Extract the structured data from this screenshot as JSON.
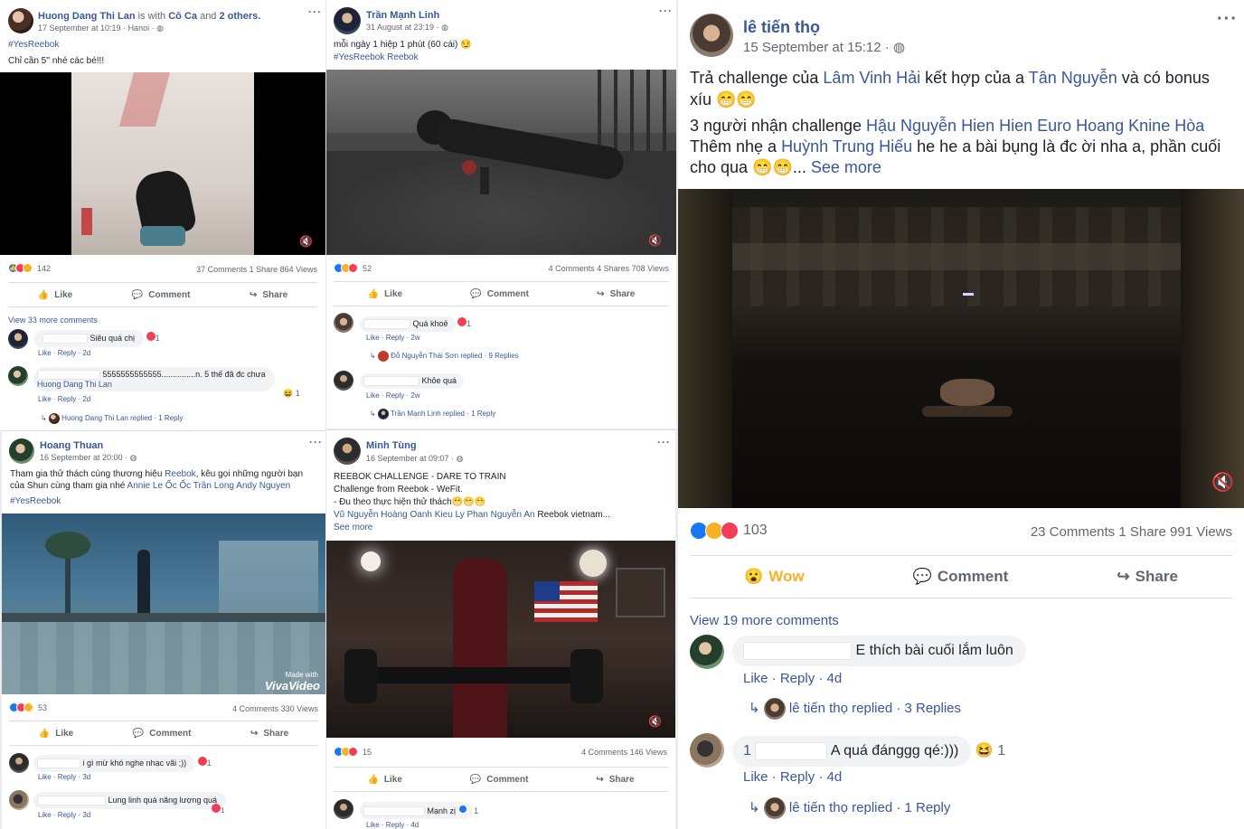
{
  "post1": {
    "author": "Huong Dang Thi Lan",
    "with_text": " is with ",
    "with_1": "Cô Ca",
    "with_and": " and ",
    "with_2": "2 others.",
    "time": "17 September at 10:19 · Hanoi ·",
    "hashtag": "#YesReebok",
    "text": "Chỉ cần 5'' nhé các bé!!!",
    "reactions": "142",
    "stats": "37 Comments  1 Share  864 Views",
    "like": "Like",
    "comment": "Comment",
    "share": "Share",
    "view_more": "View 33 more comments",
    "comments": [
      {
        "text": "Siêu quá chị",
        "count": "1",
        "meta": "Like · Reply · 2d"
      },
      {
        "text": "5555555555555...............n. 5 thế đã đc chưa",
        "tag": "Huong Dang Thi Lan",
        "count": "1",
        "meta": "Like · Reply · 2d",
        "replied": "Huong Dang Thi Lan replied · 1 Reply"
      }
    ]
  },
  "post2": {
    "author": "Trần Mạnh Linh",
    "time": "31 August at 23:19 ·",
    "text": "mỗi ngày 1 hiệp 1 phút (60 cái) 😏",
    "hashtags": "#YesReebok Reebok",
    "reactions": "52",
    "stats": "4 Comments  4 Shares  708 Views",
    "like": "Like",
    "comment": "Comment",
    "share": "Share",
    "comments": [
      {
        "text": "Quá khoẻ",
        "count": "1",
        "meta": "Like · Reply · 2w",
        "replied": "Đỗ Nguyễn Thái Sơn replied · 9 Replies"
      },
      {
        "text": "Khỏe quá",
        "meta": "Like · Reply · 2w",
        "replied": "Trần Mạnh Linh replied · 1 Reply"
      }
    ]
  },
  "post3": {
    "author": "lê tiến thọ",
    "time": "15 September at 15:12 ·",
    "line1_a": "Trả challenge của ",
    "line1_b": "Lâm Vinh Hải",
    "line1_c": " kết hợp của a ",
    "line1_d": "Tân Nguyễn",
    "line1_e": " và có bonus",
    "line2": "xíu 😁😁",
    "line3_a": "3 người nhận challenge ",
    "line3_b": "Hậu Nguyễn Hien Hien Euro Hoang Knine Hòa",
    "line4_a": "Thêm nhẹ a ",
    "line4_b": "Huỳnh Trung Hiếu",
    "line4_c": " he he a bài bụng là đc ời nha a, phần cuối",
    "line5_a": "cho qua 😁😁... ",
    "line5_b": "See more",
    "reactions": "103",
    "stats": "23 Comments  1 Share  991 Views",
    "wow": "Wow",
    "comment": "Comment",
    "share": "Share",
    "view_more": "View 19 more comments",
    "comments": [
      {
        "text": "E thích bài cuối lắm luôn",
        "meta": "Like · Reply · 4d",
        "replied": "lê tiến thọ replied · 3 Replies"
      },
      {
        "prefix": "1",
        "text": "A quá đánggg qé:)))",
        "count": "1",
        "meta": "Like · Reply · 4d",
        "replied": "lê tiến thọ replied · 1 Reply"
      }
    ]
  },
  "post4": {
    "author": "Hoang Thuan",
    "time": "16 September at 20:00 ·",
    "text_a": "Tham gia thử thách cùng thương hiệu ",
    "text_b": "Reebok",
    "text_c": ", kêu gọi những người bạn",
    "line2_a": "của Shun cùng tham gia nhé ",
    "line2_b": "Annie Le Ốc Ốc Trần Long Andy Nguyen",
    "hashtag": "#YesReebok",
    "watermark_small": "Made with",
    "watermark": "VivaVideo",
    "reactions": "53",
    "stats": "4 Comments  330 Views",
    "like": "Like",
    "comment": "Comment",
    "share": "Share",
    "comments": [
      {
        "text": "i gì mừ khó nghe nhạc vãi ;))",
        "count": "1",
        "meta": "Like · Reply · 3d"
      },
      {
        "text": "Lung linh quá năng lượng quá",
        "count": "1",
        "meta": "Like · Reply · 3d"
      }
    ]
  },
  "post5": {
    "author": "Minh Tùng",
    "time": "16 September at 09:07 ·",
    "line1": "REEBOK CHALLENGE - DARE TO TRAIN",
    "line2": "Challenge from Reebok - WeFit.",
    "line3": "- Đu theo thực hiện thử thách😁😁😁",
    "line4_a": "Vũ Nguyễn Hoàng Oanh Kieu Ly Phan Nguyễn An",
    "line4_b": " Reebok vietnam...",
    "see_more": "See more",
    "reactions": "15",
    "stats": "4 Comments  146 Views",
    "like": "Like",
    "comment": "Comment",
    "share": "Share",
    "comments": [
      {
        "text": "Mạnh zị",
        "count": "1",
        "meta": "Like · Reply · 4d"
      }
    ]
  },
  "ui": {
    "dots": "···",
    "mute": "🔇",
    "reply_arrow": "↳"
  }
}
